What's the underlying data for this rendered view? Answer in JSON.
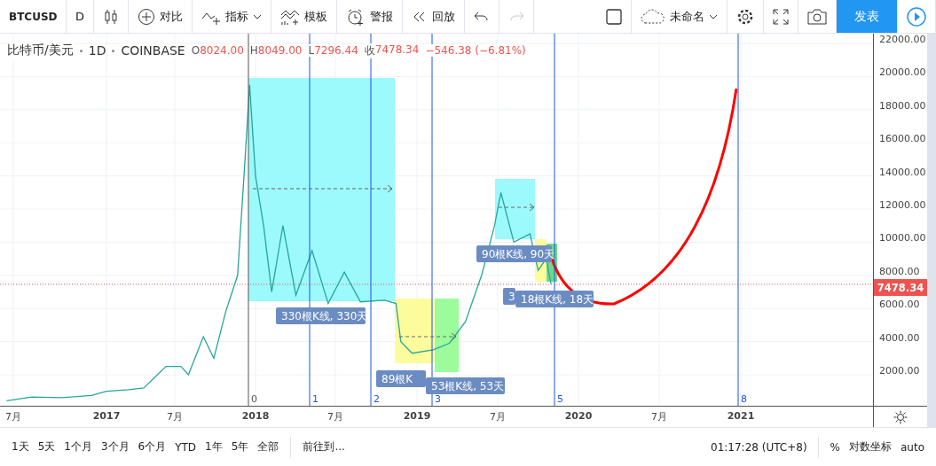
{
  "toolbar": {
    "symbol": "BTCUSD",
    "interval": "D",
    "buttons": [
      {
        "kind": "candles"
      },
      {
        "kind": "compare",
        "label": "对比"
      },
      {
        "kind": "indicators",
        "label": "指标"
      },
      {
        "kind": "templates",
        "label": "模板"
      },
      {
        "kind": "alert",
        "label": "警报"
      },
      {
        "kind": "replay",
        "label": "回放"
      },
      {
        "kind": "undo",
        "disabled": false
      },
      {
        "kind": "redo",
        "disabled": true
      }
    ],
    "right_buttons": [
      {
        "kind": "layout"
      },
      {
        "kind": "cloud",
        "label": "未命名"
      },
      {
        "kind": "settings"
      },
      {
        "kind": "fullscreen"
      },
      {
        "kind": "snapshot"
      },
      {
        "kind": "publish",
        "label": "发表"
      },
      {
        "kind": "play"
      }
    ]
  },
  "legend": {
    "title": "比特币/美元",
    "interval": "1D",
    "exchange": "COINBASE",
    "ohlc": [
      {
        "label": "O",
        "value": "8024.00"
      },
      {
        "label": "H",
        "value": "8049.00"
      },
      {
        "label": "L",
        "value": "7296.44"
      },
      {
        "label": "收",
        "value": "7478.34"
      }
    ],
    "change": "−546.38 (−6.81%)"
  },
  "chart": {
    "time_zone_labels": [
      "0",
      "1",
      "2",
      "3",
      "5",
      "8"
    ],
    "range_labels": [
      "330根K线, 330天",
      "90根K线, 90天",
      "3",
      "18根K线, 18天",
      "89根K",
      "53根K线, 53天"
    ]
  },
  "price_axis": {
    "labels": [
      "22000.00",
      "20000.00",
      "18000.00",
      "16000.00",
      "14000.00",
      "12000.00",
      "10000.00",
      "8000.00",
      "6000.00",
      "4000.00",
      "2000.00"
    ],
    "last_price": "7478.34"
  },
  "time_axis": {
    "labels": [
      "7月",
      "2017",
      "7月",
      "2018",
      "7月",
      "2019",
      "7月",
      "2020",
      "7月",
      "2021"
    ]
  },
  "bottom_bar": {
    "ranges": [
      "1天",
      "5天",
      "1个月",
      "3个月",
      "6个月",
      "YTD",
      "1年",
      "5年",
      "全部"
    ],
    "goto": "前往到...",
    "time": "01:17:28 (UTC+8)",
    "percent": "%",
    "log_scale": "对数坐标",
    "auto": "auto"
  }
}
